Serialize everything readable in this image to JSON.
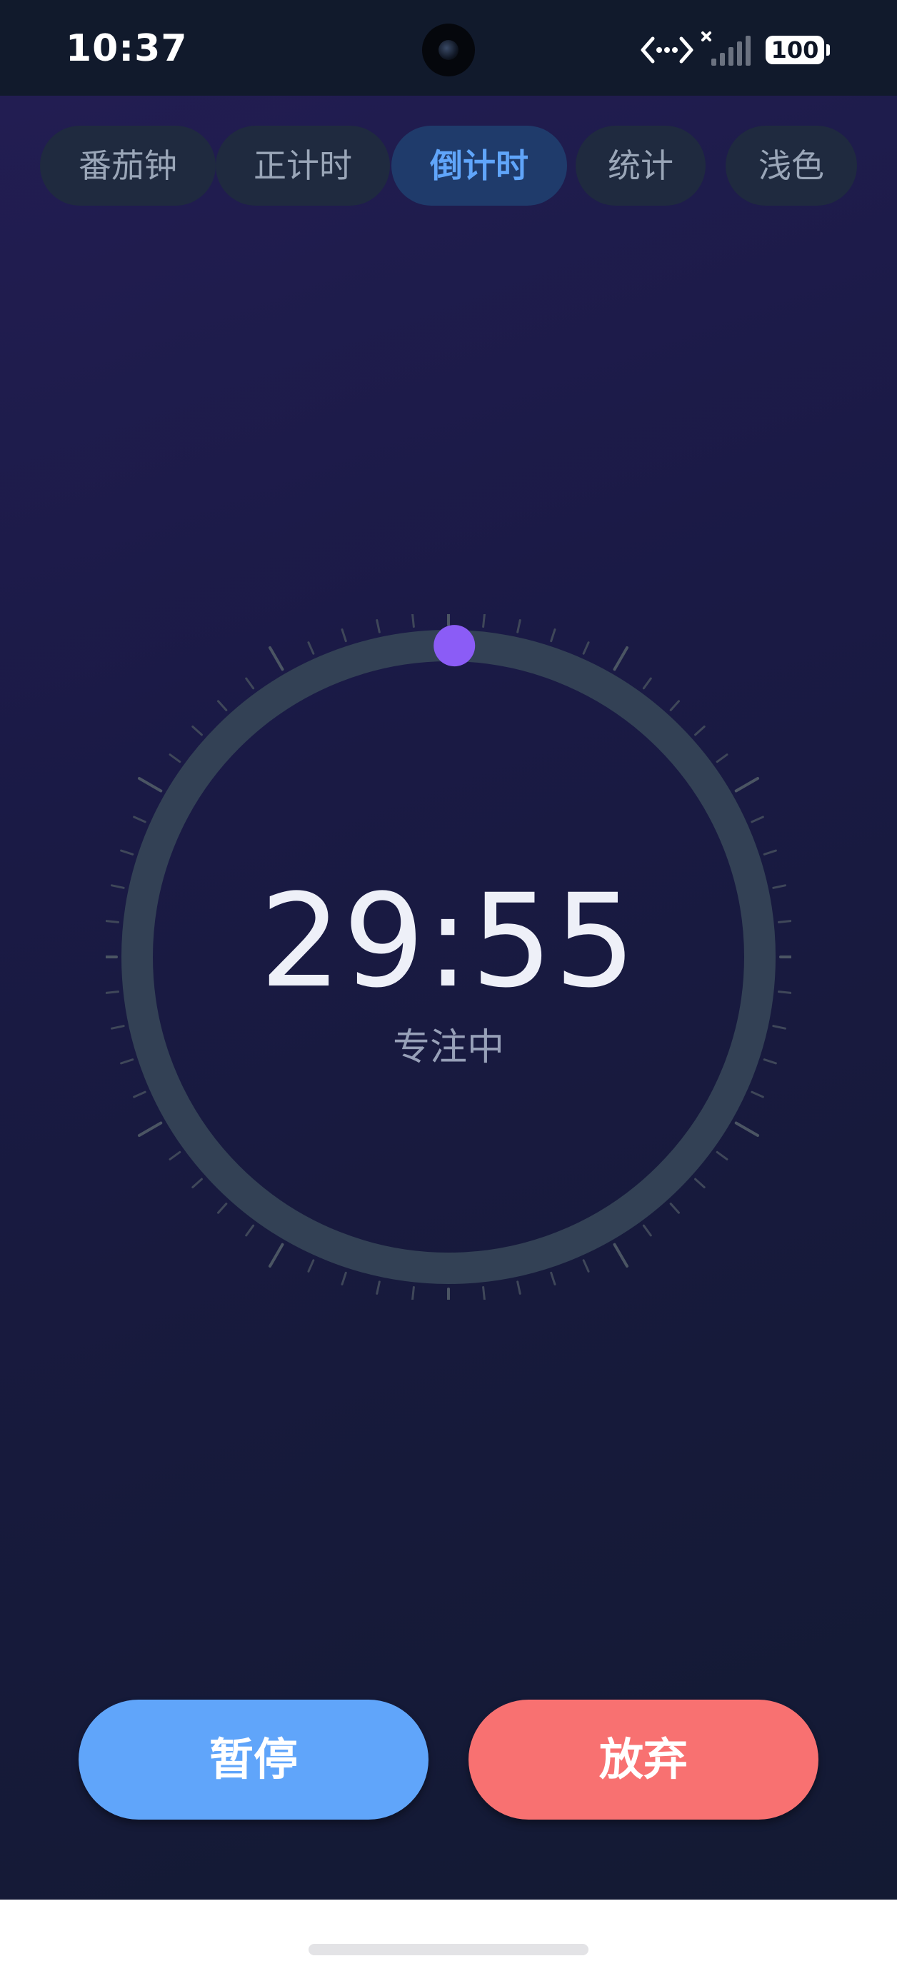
{
  "status_bar": {
    "time": "10:37",
    "battery": "100",
    "icons": [
      "data-transfer-icon",
      "signal-no-service-icon",
      "battery-icon"
    ]
  },
  "tabs": [
    {
      "label": "番茄钟",
      "active": false
    },
    {
      "label": "正计时",
      "active": false
    },
    {
      "label": "倒计时",
      "active": true
    },
    {
      "label": "统计",
      "active": false
    },
    {
      "label": "浅色",
      "active": false
    }
  ],
  "timer": {
    "value": "29:55",
    "status": "专注中",
    "progress": 0.003
  },
  "actions": {
    "pause_label": "暂停",
    "quit_label": "放弃"
  },
  "colors": {
    "accent": "#60a5fa",
    "danger": "#f87171",
    "progress_dot": "#8b5cf6",
    "ring": "#334155"
  }
}
